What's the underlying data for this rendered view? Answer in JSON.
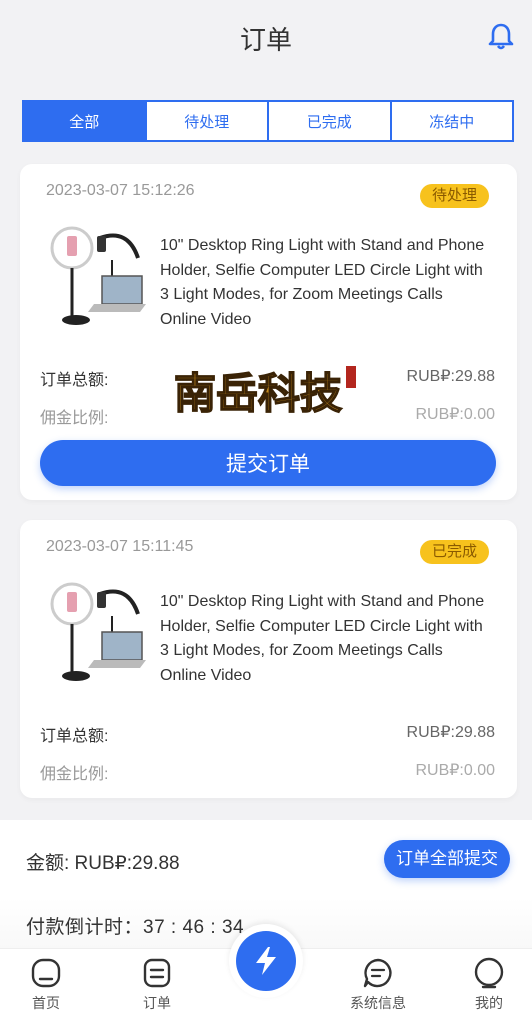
{
  "header": {
    "title": "订单",
    "icon": "bell-icon"
  },
  "tabs": [
    {
      "label": "全部",
      "active": true
    },
    {
      "label": "待处理",
      "active": false
    },
    {
      "label": "已完成",
      "active": false
    },
    {
      "label": "冻结中",
      "active": false
    }
  ],
  "orders": [
    {
      "time": "2023-03-07 15:12:26",
      "status": "待处理",
      "product_name": "10\" Desktop Ring Light with Stand and Phone Holder, Selfie Computer LED Circle Light with 3 Light Modes, for Zoom Meetings Calls Online Video",
      "total_label": "订单总额:",
      "total_value": "RUB₽:29.88",
      "commission_label": "佣金比例:",
      "commission_value": "RUB₽:0.00",
      "submit_label": "提交订单",
      "watermark_text": "南岳科技"
    },
    {
      "time": "2023-03-07 15:11:45",
      "status": "已完成",
      "product_name": "10\" Desktop Ring Light with Stand and Phone Holder, Selfie Computer LED Circle Light with 3 Light Modes, for Zoom Meetings Calls Online Video",
      "total_label": "订单总额:",
      "total_value": "RUB₽:29.88",
      "commission_label": "佣金比例:",
      "commission_value": "RUB₽:0.00"
    }
  ],
  "summary": {
    "amount": "金额:  RUB₽:29.88",
    "submit_all_label": "订单全部提交",
    "countdown": "付款倒计时：37 : 46 : 34"
  },
  "nav": [
    {
      "label": "首页",
      "icon": "home-icon"
    },
    {
      "label": "订单",
      "icon": "order-icon"
    },
    {
      "label": "系统信息",
      "icon": "message-icon"
    },
    {
      "label": "我的",
      "icon": "profile-icon"
    }
  ],
  "colors": {
    "primary": "#2e6df0",
    "badge": "#f7c21d",
    "background": "#f2f2f4"
  }
}
